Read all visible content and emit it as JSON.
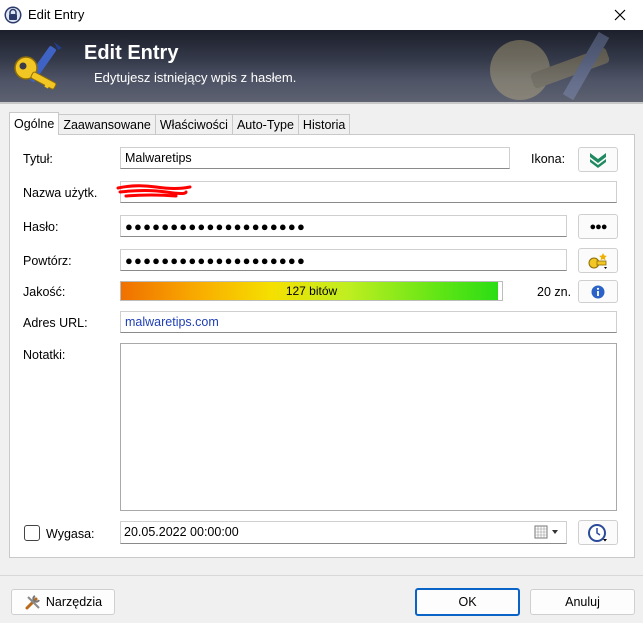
{
  "window": {
    "title": "Edit Entry"
  },
  "banner": {
    "title": "Edit Entry",
    "subtitle": "Edytujesz istniejący wpis z hasłem."
  },
  "tabs": [
    {
      "label": "Ogólne",
      "active": true
    },
    {
      "label": "Zaawansowane",
      "active": false
    },
    {
      "label": "Właściwości",
      "active": false
    },
    {
      "label": "Auto-Type",
      "active": false
    },
    {
      "label": "Historia",
      "active": false
    }
  ],
  "form": {
    "title_label": "Tytuł:",
    "title_value": "Malwaretips",
    "icon_label": "Ikona:",
    "username_label": "Nazwa użytk.",
    "username_value": "",
    "password_label": "Hasło:",
    "password_value": "●●●●●●●●●●●●●●●●●●●●",
    "repeat_label": "Powtórz:",
    "repeat_value": "●●●●●●●●●●●●●●●●●●●●",
    "show_password_label": "●●●",
    "quality_label": "Jakość:",
    "quality_text": "127 bitów",
    "quality_fraction": 0.99,
    "char_count": "20 zn.",
    "url_label": "Adres URL:",
    "url_value": "malwaretips.com",
    "notes_label": "Notatki:",
    "notes_value": "",
    "expires_label": "Wygasa:",
    "expires_checked": false,
    "expires_value": "20.05.2022 00:00:00"
  },
  "footer": {
    "tools_label": "Narzędzia",
    "ok_label": "OK",
    "cancel_label": "Anuluj"
  },
  "colors": {
    "accent": "#0a64c8",
    "url_text": "#1f3fb4",
    "banner_dark": "#1c1f2b",
    "redaction": "#ff0000"
  },
  "icons": [
    "lock-icon",
    "close-icon",
    "keys-icon",
    "entry-icon",
    "dots-icon",
    "generator-icon",
    "info-icon",
    "calendar-icon",
    "clock-icon",
    "tools-icon"
  ]
}
